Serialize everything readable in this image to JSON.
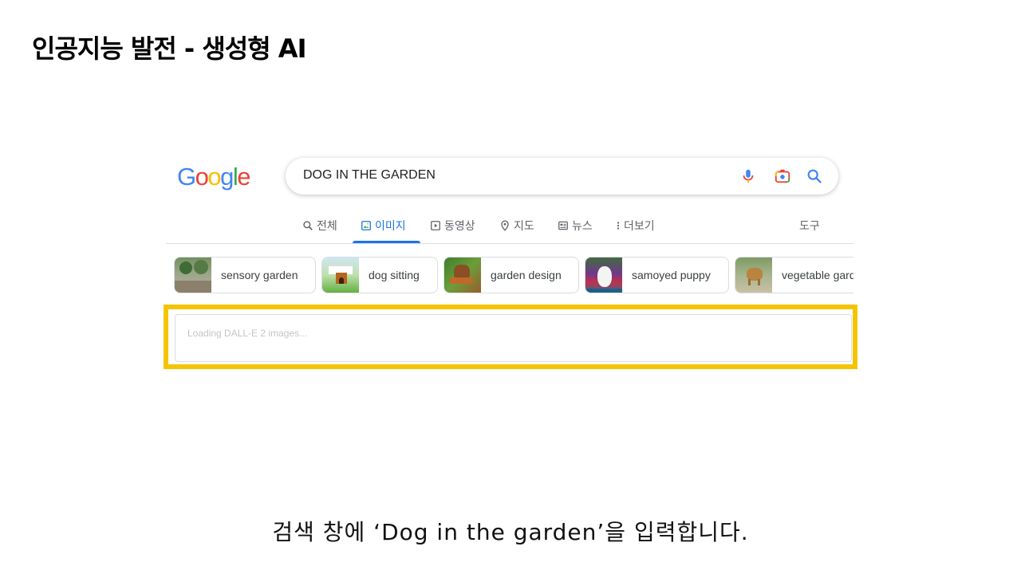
{
  "slide": {
    "title": "인공지능 발전 - 생성형 AI",
    "caption": "검색 창에 ‘Dog in the garden’을 입력합니다."
  },
  "google": {
    "logo_letters": [
      "G",
      "o",
      "o",
      "g",
      "l",
      "e"
    ],
    "logo_colors": [
      "#4285F4",
      "#EA4335",
      "#FBBC05",
      "#4285F4",
      "#34A853",
      "#EA4335"
    ],
    "search_value": "DOG IN THE GARDEN",
    "icons": {
      "voice": "microphone-icon",
      "lens": "camera-lens-icon",
      "search": "search-icon"
    }
  },
  "tabs": [
    {
      "label": "전체",
      "icon": "search-icon",
      "active": false
    },
    {
      "label": "이미지",
      "icon": "image-icon",
      "active": true
    },
    {
      "label": "동영상",
      "icon": "play-icon",
      "active": false
    },
    {
      "label": "지도",
      "icon": "map-pin-icon",
      "active": false
    },
    {
      "label": "뉴스",
      "icon": "news-icon",
      "active": false
    },
    {
      "label": "더보기",
      "icon": "more-vert-icon",
      "active": false
    }
  ],
  "tools_label": "도구",
  "chips": [
    {
      "label": "sensory garden"
    },
    {
      "label": "dog sitting"
    },
    {
      "label": "garden design"
    },
    {
      "label": "samoyed puppy"
    },
    {
      "label": "vegetable garden"
    }
  ],
  "loading": {
    "text": "Loading DALL-E 2 images..."
  },
  "colors": {
    "highlight": "#f5c400",
    "active_tab": "#1a73e8"
  }
}
